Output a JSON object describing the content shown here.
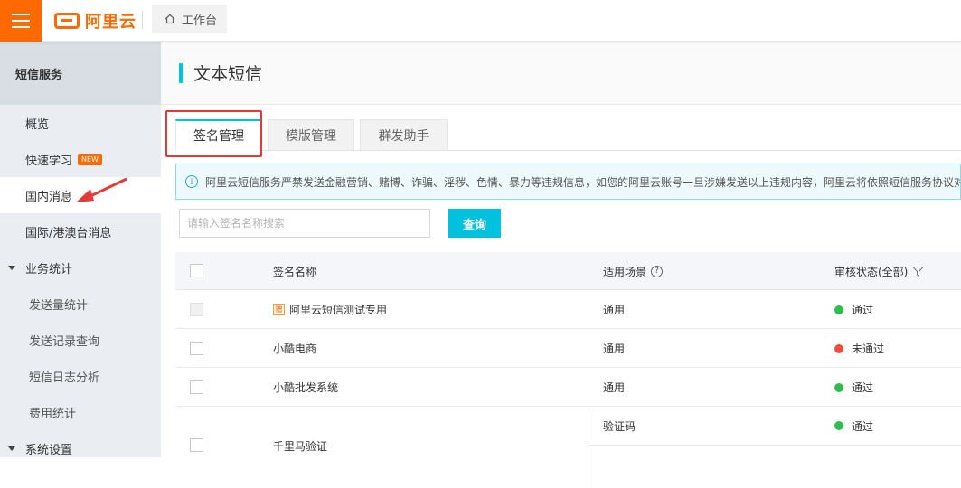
{
  "brand": {
    "name": "阿里云",
    "accent": "#ff6a00"
  },
  "topbar": {
    "workbench_label": "工作台"
  },
  "sidebar": {
    "title": "短信服务",
    "items": [
      {
        "label": "概览"
      },
      {
        "label": "快速学习",
        "badge": "NEW"
      },
      {
        "label": "国内消息"
      },
      {
        "label": "国际/港澳台消息"
      },
      {
        "label": "业务统计"
      },
      {
        "label": "发送量统计"
      },
      {
        "label": "发送记录查询"
      },
      {
        "label": "短信日志分析"
      },
      {
        "label": "费用统计"
      },
      {
        "label": "系统设置"
      }
    ]
  },
  "main": {
    "title": "文本短信",
    "tabs": [
      {
        "label": "签名管理"
      },
      {
        "label": "模版管理"
      },
      {
        "label": "群发助手"
      }
    ],
    "notice": "阿里云短信服务严禁发送金融营销、赌博、诈骗、淫秽、色情、暴力等违规信息，如您的阿里云账号一旦涉嫌发送以上违规内容，阿里云将依照短信服务协议对",
    "search": {
      "placeholder": "请输入签名名称搜索",
      "button_label": "查询"
    },
    "table": {
      "columns": [
        "签名名称",
        "适用场景",
        "审核状态(全部)"
      ],
      "rows": [
        {
          "name": "阿里云短信测试专用",
          "icon_text": "赠",
          "scene": "通用",
          "status": "通过",
          "status_color": "#2dbe4e"
        },
        {
          "name": "小酷电商",
          "scene": "通用",
          "status": "未通过",
          "status_color": "#f04c3b"
        },
        {
          "name": "小酷批发系统",
          "scene": "通用",
          "status": "通过",
          "status_color": "#2dbe4e"
        },
        {
          "name": "千里马验证",
          "scene": "验证码",
          "status": "通过",
          "status_color": "#2dbe4e"
        }
      ]
    }
  }
}
